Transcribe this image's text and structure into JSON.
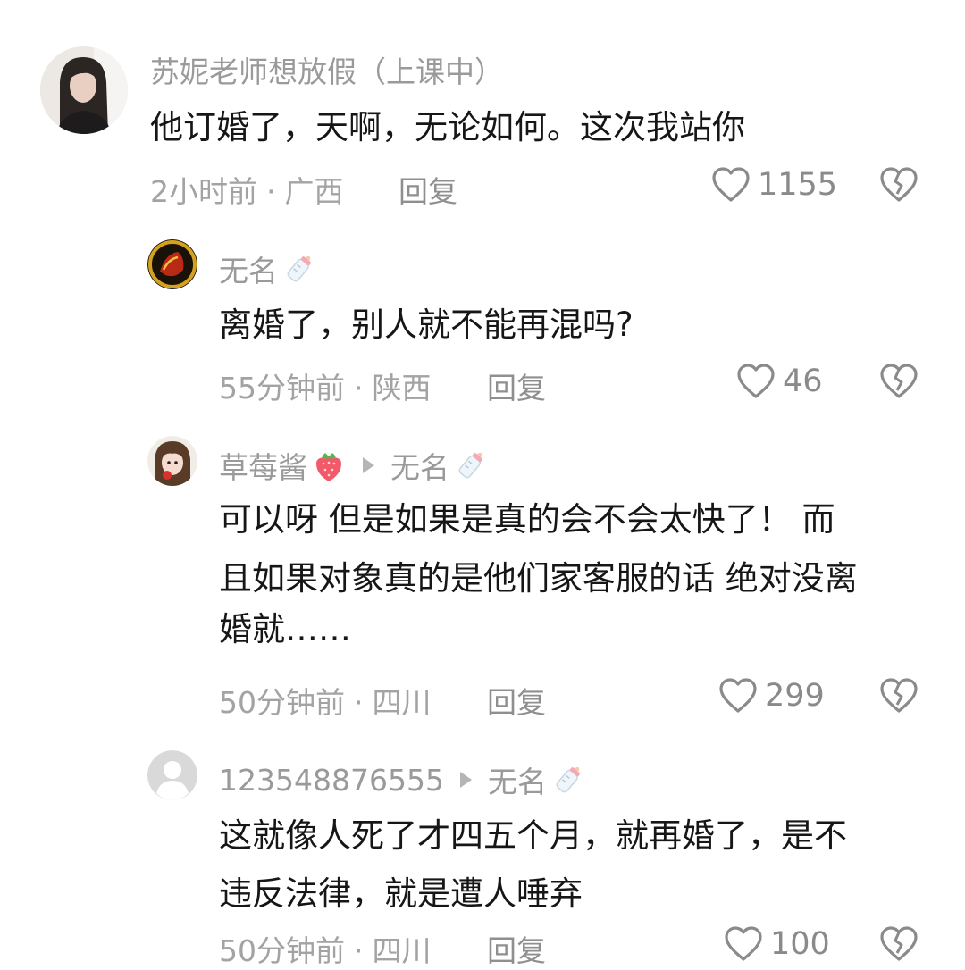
{
  "comments": [
    {
      "name": "苏妮老师想放假（上课中）",
      "text": [
        "他订婚了，天啊，无论如何。这次我站你"
      ],
      "time": "2小时前",
      "location": "广西",
      "reply": "回复",
      "likes": "1155"
    },
    {
      "name": "无名",
      "text": [
        "离婚了，别人就不能再混吗?"
      ],
      "time": "55分钟前",
      "location": "陕西",
      "reply": "回复",
      "likes": "46"
    },
    {
      "name": "草莓酱",
      "reply_to": "无名",
      "text": [
        "可以呀 但是如果是真的会不会太快了！ 而",
        "且如果对象真的是他们家客服的话 绝对没离",
        "婚就……"
      ],
      "time": "50分钟前",
      "location": "四川",
      "reply": "回复",
      "likes": "299"
    },
    {
      "name": "123548876555",
      "reply_to": "无名",
      "text": [
        "这就像人死了才四五个月，就再婚了，是不",
        "违反法律，就是遭人唾弃"
      ],
      "time": "50分钟前",
      "location": "四川",
      "reply": "回复",
      "likes": "100"
    }
  ],
  "icons": {
    "like": "heart-outline-icon",
    "dislike": "broken-heart-icon",
    "badge": "baby-bottle-icon",
    "reply_arrow": "triangle-right-icon"
  },
  "colors": {
    "name": "#9a9a9a",
    "meta": "#a3a3a3",
    "text": "#161616",
    "icon": "#8a8a8a"
  }
}
